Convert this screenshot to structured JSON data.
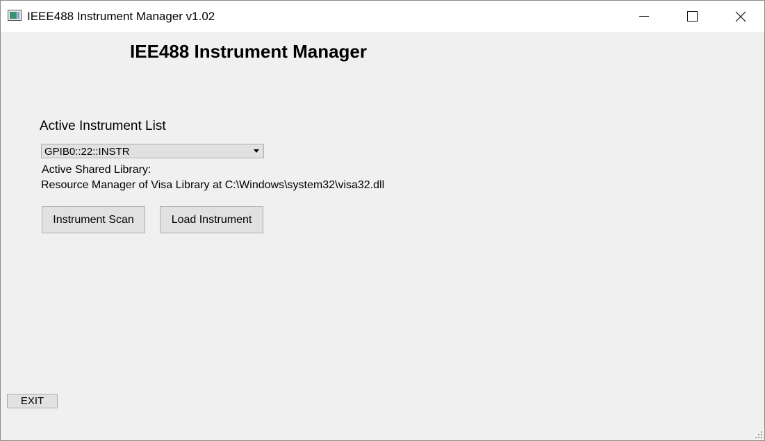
{
  "window": {
    "title": "IEEE488 Instrument Manager v1.02",
    "icon": "app-icon"
  },
  "controls": {
    "minimize_icon": "minimize-icon",
    "maximize_icon": "maximize-icon",
    "close_icon": "close-icon"
  },
  "main": {
    "title": "IEE488 Instrument Manager",
    "instrument_list_label": "Active Instrument List",
    "selected_instrument": "GPIB0::22::INSTR",
    "shared_library_label": "Active Shared Library:",
    "shared_library_path": "Resource Manager of Visa Library at C:\\Windows\\system32\\visa32.dll",
    "scan_button": "Instrument Scan",
    "load_button": "Load Instrument",
    "exit_button": "EXIT"
  },
  "colors": {
    "background": "#f0f0f0",
    "titlebar": "#ffffff",
    "button_face": "#e1e1e1",
    "button_border": "#adadad"
  }
}
